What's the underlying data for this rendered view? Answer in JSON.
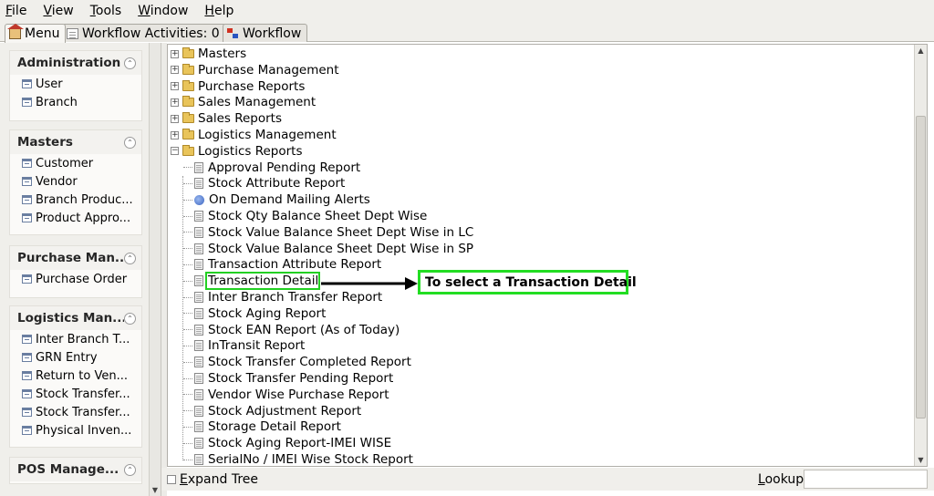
{
  "menubar": [
    "File",
    "View",
    "Tools",
    "Window",
    "Help"
  ],
  "tabs": [
    {
      "label": "Menu",
      "icon": "home-icon",
      "active": true
    },
    {
      "label": "Workflow Activities: 0",
      "icon": "document-icon",
      "active": false
    },
    {
      "label": "Workflow",
      "icon": "workflow-icon",
      "active": false
    }
  ],
  "sidebar": {
    "groups": [
      {
        "title": "Administration",
        "items": [
          "User",
          "Branch"
        ]
      },
      {
        "title": "Masters",
        "items": [
          "Customer",
          "Vendor",
          "Branch Produc...",
          "Product Appro..."
        ]
      },
      {
        "title": "Purchase Man...",
        "items": [
          "Purchase Order"
        ]
      },
      {
        "title": "Logistics Man...",
        "items": [
          "Inter Branch T...",
          "GRN Entry",
          "Return to Ven...",
          "Stock Transfer...",
          "Stock Transfer...",
          "Physical Inven..."
        ]
      },
      {
        "title": "POS Manage...",
        "items": []
      }
    ]
  },
  "tree": {
    "folders": [
      "Masters",
      "Purchase Management",
      "Purchase Reports",
      "Sales Management",
      "Sales Reports",
      "Logistics Management",
      "Logistics Reports"
    ],
    "expanded_folder": "Logistics Reports",
    "reports": [
      {
        "label": "Approval Pending Report",
        "icon": "document-icon"
      },
      {
        "label": "Stock Attribute Report",
        "icon": "document-icon"
      },
      {
        "label": "On Demand Mailing Alerts",
        "icon": "globe-icon"
      },
      {
        "label": "Stock Qty Balance Sheet Dept Wise",
        "icon": "document-icon"
      },
      {
        "label": "Stock Value Balance Sheet Dept Wise in LC",
        "icon": "document-icon"
      },
      {
        "label": "Stock Value Balance Sheet Dept Wise in SP",
        "icon": "document-icon"
      },
      {
        "label": "Transaction Attribute Report",
        "icon": "document-icon"
      },
      {
        "label": "Transaction Detail",
        "icon": "document-icon"
      },
      {
        "label": "Inter Branch Transfer Report",
        "icon": "document-icon"
      },
      {
        "label": "Stock Aging Report",
        "icon": "document-icon"
      },
      {
        "label": "Stock EAN Report (As of Today)",
        "icon": "document-icon"
      },
      {
        "label": "InTransit Report",
        "icon": "document-icon"
      },
      {
        "label": "Stock Transfer Completed Report",
        "icon": "document-icon"
      },
      {
        "label": "Stock Transfer Pending Report",
        "icon": "document-icon"
      },
      {
        "label": "Vendor Wise Purchase Report",
        "icon": "document-icon"
      },
      {
        "label": "Stock Adjustment Report",
        "icon": "document-icon"
      },
      {
        "label": "Storage Detail Report",
        "icon": "document-icon"
      },
      {
        "label": "Stock Aging Report-IMEI WISE",
        "icon": "document-icon"
      },
      {
        "label": "SerialNo / IMEI Wise Stock Report",
        "icon": "document-icon"
      }
    ],
    "highlighted": "Transaction Detail"
  },
  "annotation": {
    "text": "To select a Transaction Detail",
    "color": "#22dd22"
  },
  "bottom": {
    "expand_label": "Expand Tree",
    "lookup_label": "Lookup",
    "lookup_value": ""
  }
}
